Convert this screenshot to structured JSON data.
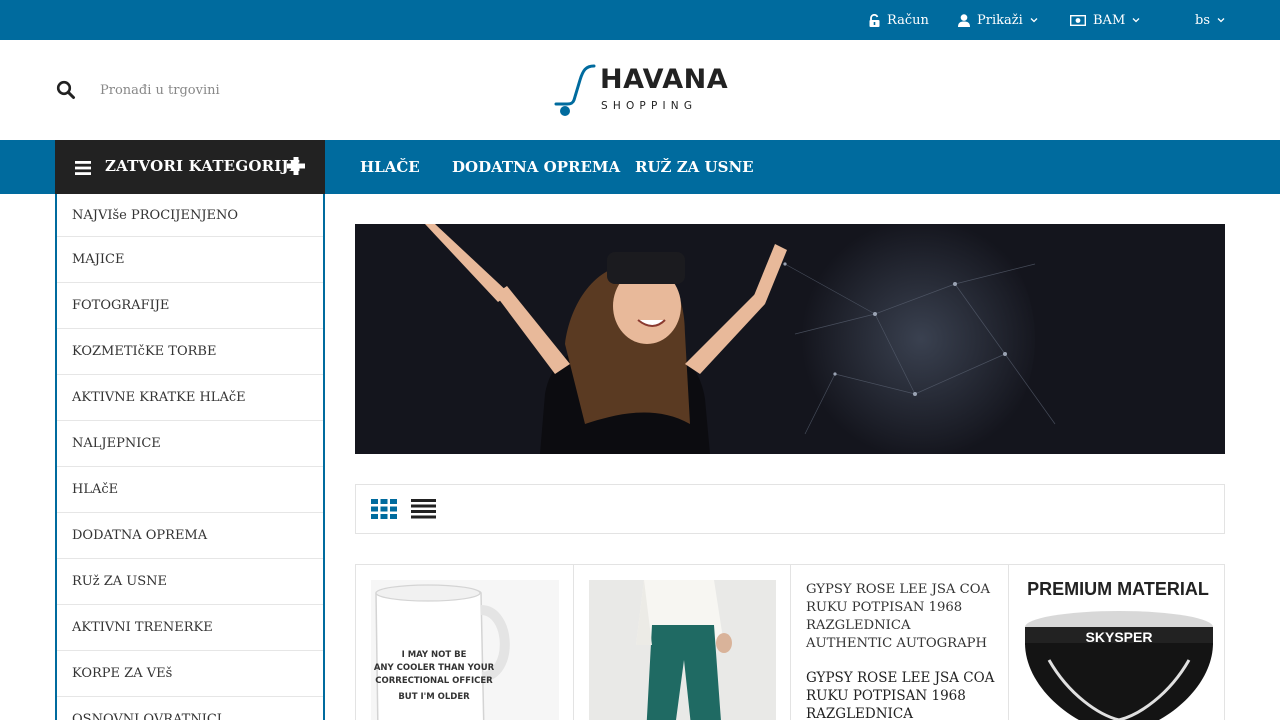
{
  "topbar": {
    "account": "Račun",
    "show": "Prikaži",
    "currency": "BAM",
    "language": "bs"
  },
  "header": {
    "search_placeholder": "Pronađi u trgovini",
    "logo_title": "HAVANA",
    "logo_subtitle": "SHOPPING"
  },
  "nav": {
    "categories_toggle": "ZATVORI KATEGORIJE",
    "links": [
      "HLAČE",
      "DODATNA OPREMA",
      "RUŽ ZA USNE"
    ]
  },
  "sidebar": {
    "items": [
      "NAJVIše PROCIJENJENO",
      "MAJICE",
      "FOTOGRAFIJE",
      "KOZMETIčKE TORBE",
      "AKTIVNE KRATKE HLAčE",
      "NALJEPNICE",
      "HLAčE",
      "DODATNA OPREMA",
      "RUž ZA USNE",
      "AKTIVNI TRENERKE",
      "KORPE ZA VEš",
      "OSNOVNI OVRATNICI"
    ]
  },
  "products": [
    {
      "image": "mug",
      "mug_text": [
        "I MAY NOT BE",
        "ANY COOLER THAN YOUR",
        "CORRECTIONAL OFFICER",
        "BUT I'M OLDER"
      ]
    },
    {
      "image": "green-pants"
    },
    {
      "image_alt": "GYPSY ROSE LEE JSA COA RUKU POTPISAN 1968 RAZGLEDNICA AUTHENTIC AUTOGRAPH",
      "name": "GYPSY ROSE LEE JSA COA RUKU POTPISAN 1968 RAZGLEDNICA AUTHENTIC"
    },
    {
      "image": "underwear",
      "banner_text": "PREMIUM MATERIAL",
      "brand": "SKYSPER"
    }
  ],
  "colors": {
    "brand_blue": "#006b9e",
    "dark": "#222222"
  }
}
